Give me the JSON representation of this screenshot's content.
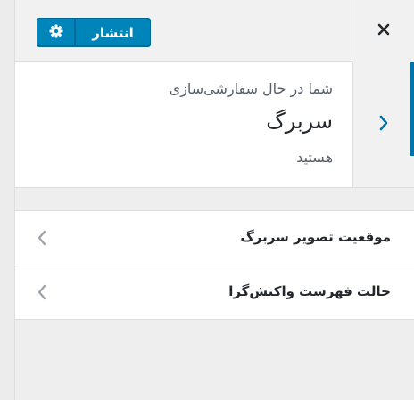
{
  "header": {
    "publish_label": "انتشار",
    "settings_icon": "gear-icon",
    "close_icon": "close-icon"
  },
  "info": {
    "line1": "شما در حال سفارشی‌سازی",
    "title": "سربرگ",
    "line3": "هستید",
    "back_icon": "chevron-right-icon"
  },
  "menu": {
    "items": [
      {
        "label": "موقعیت تصویر سربرگ",
        "icon": "chevron-left-icon"
      },
      {
        "label": "حالت فهرست واکنش‌گرا",
        "icon": "chevron-left-icon"
      }
    ]
  },
  "colors": {
    "accent": "#0085ba",
    "accent_dark": "#006799",
    "active_bar": "#0073aa"
  }
}
